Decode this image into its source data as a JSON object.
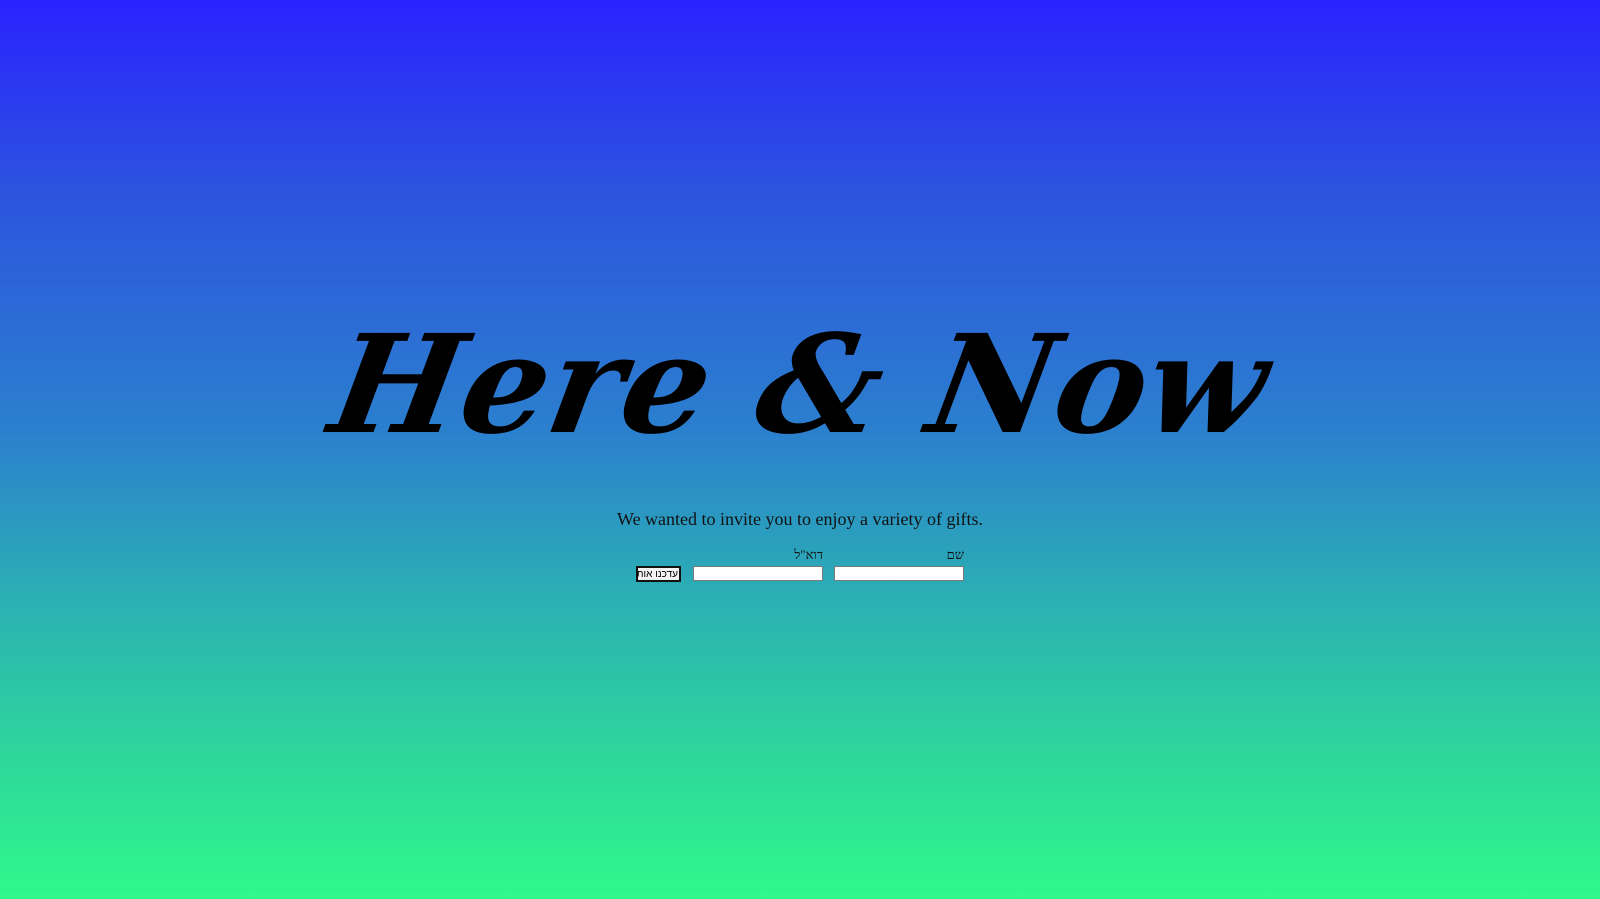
{
  "hero": {
    "title": "Here & Now"
  },
  "subtitle": "We wanted to invite you to enjoy a variety of gifts.",
  "form": {
    "name_label": "שם",
    "name_value": "",
    "email_label": "דוא\"ל",
    "email_value": "",
    "submit_label": "עדכנו אותי"
  },
  "colors": {
    "gradient_top": "#2a22ff",
    "gradient_mid": "#2b80ce",
    "gradient_bottom": "#2ff98b",
    "text": "#000000"
  }
}
